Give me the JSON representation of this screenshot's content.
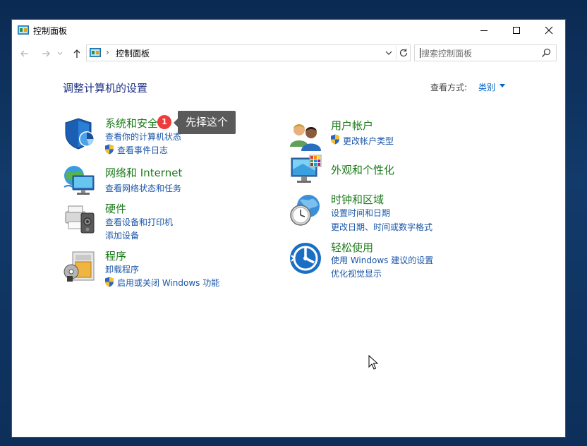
{
  "window": {
    "title": "控制面板",
    "controls": {
      "minimize": "minimize-icon",
      "maximize": "maximize-icon",
      "close": "close-icon"
    }
  },
  "nav": {
    "address_path": "控制面板",
    "address_separator": "›",
    "search_placeholder": "搜索控制面板"
  },
  "main": {
    "heading": "调整计算机的设置",
    "view_by_label": "查看方式:",
    "view_by_value": "类别"
  },
  "categories_left": [
    {
      "title": "系统和安全",
      "icon": "system-security-icon",
      "links": [
        "查看你的计算机状态",
        "查看事件日志"
      ]
    },
    {
      "title": "网络和 Internet",
      "icon": "network-internet-icon",
      "links": [
        "查看网络状态和任务"
      ]
    },
    {
      "title": "硬件",
      "icon": "hardware-sound-icon",
      "links": [
        "查看设备和打印机",
        "添加设备"
      ]
    },
    {
      "title": "程序",
      "icon": "programs-icon",
      "links": [
        "卸载程序",
        "启用或关闭 Windows 功能"
      ]
    }
  ],
  "categories_right": [
    {
      "title": "用户帐户",
      "icon": "user-accounts-icon",
      "links": [
        "更改帐户类型"
      ]
    },
    {
      "title": "外观和个性化",
      "icon": "appearance-icon",
      "links": []
    },
    {
      "title": "时钟和区域",
      "icon": "clock-region-icon",
      "links": [
        "设置时间和日期",
        "更改日期、时间或数字格式"
      ]
    },
    {
      "title": "轻松使用",
      "icon": "ease-of-access-icon",
      "links": [
        "使用 Windows 建议的设置",
        "优化视觉显示"
      ]
    }
  ],
  "annotation": {
    "badge": "1",
    "tooltip": "先择这个"
  },
  "colors": {
    "category_title": "#1a7a1a",
    "link": "#1a56a8",
    "heading": "#1e3287",
    "badge": "#ef3b3b",
    "tooltip_bg": "#5a5a5a"
  }
}
